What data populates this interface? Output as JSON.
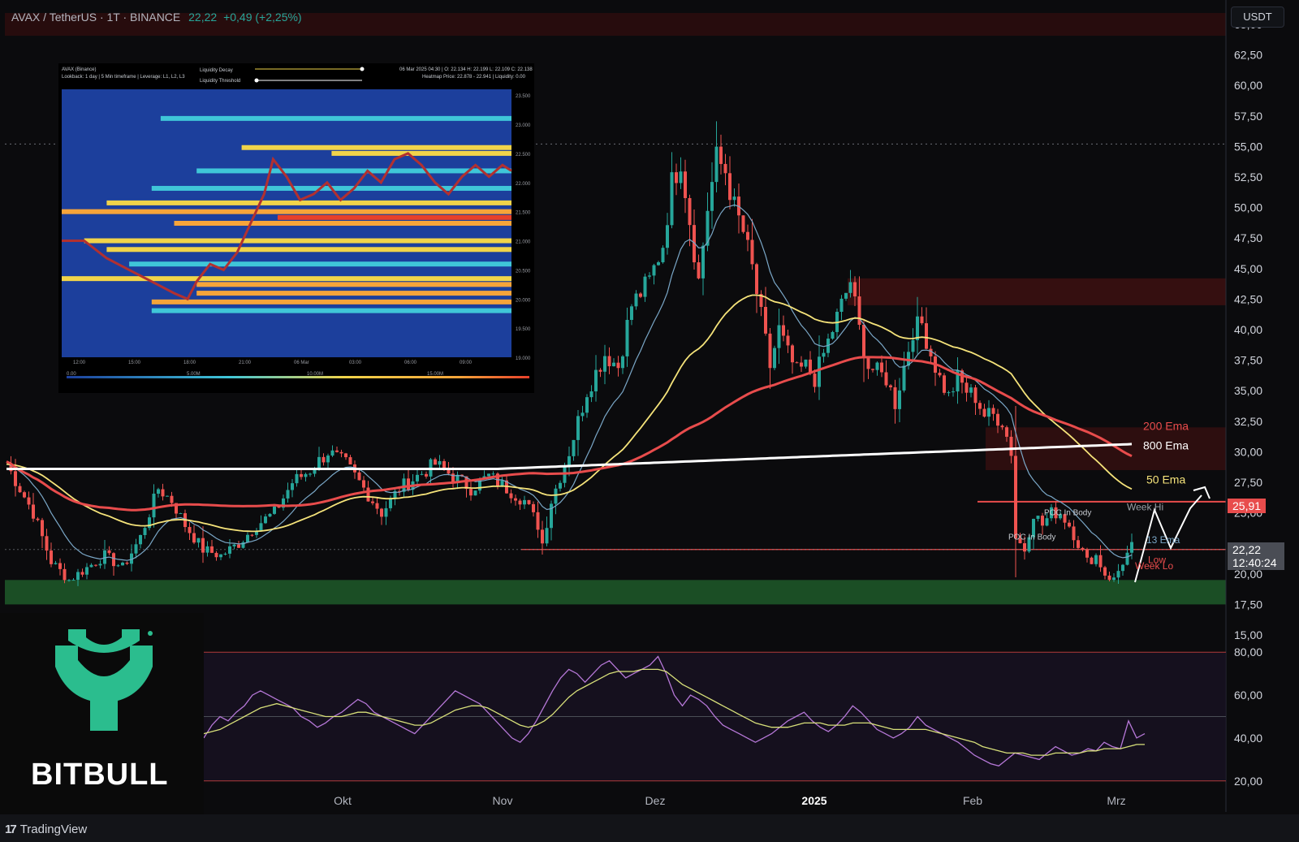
{
  "header": {
    "symbol": "AVAX / TetherUS · 1T · BINANCE",
    "last": "22,22",
    "change": "+0,49 (+2,25%)"
  },
  "currency_button": "USDT",
  "brand": {
    "name": "BITBULL",
    "color": "#2bbd8e"
  },
  "footer": {
    "logo_text": "TradingView"
  },
  "colors": {
    "up": "#26a69a",
    "down": "#ef5350",
    "ema50": "#f5e37a",
    "ema200": "#e84c4c",
    "ema800": "#ffffff",
    "rsi": "#b678d8",
    "rsi_ma": "#d8e07a",
    "support_zone": "#1f5a2a"
  },
  "price_tags": {
    "level": "25,91",
    "current_price": "22,22",
    "countdown": "12:40:24"
  },
  "chart_data": [
    {
      "type": "candlestick",
      "title": "AVAX / TetherUS · 1T · BINANCE",
      "x_ticks": [
        "Okt",
        "Nov",
        "Dez",
        "2025",
        "Feb",
        "Mrz"
      ],
      "y_ticks": [
        "65,00",
        "62,50",
        "60,00",
        "57,50",
        "55,00",
        "52,50",
        "50,00",
        "47,50",
        "45,00",
        "42,50",
        "40,00",
        "37,50",
        "35,00",
        "32,50",
        "30,00",
        "27,50",
        "25,00",
        "22,22",
        "20,00",
        "17,50",
        "15,00"
      ],
      "ylim": [
        15,
        65
      ],
      "close_path": [
        [
          0,
          29
        ],
        [
          6,
          25
        ],
        [
          10,
          21
        ],
        [
          14,
          19.5
        ],
        [
          18,
          20.5
        ],
        [
          22,
          21.5
        ],
        [
          26,
          20.5
        ],
        [
          30,
          23
        ],
        [
          34,
          27
        ],
        [
          37,
          26
        ],
        [
          40,
          24
        ],
        [
          44,
          22
        ],
        [
          48,
          21.5
        ],
        [
          52,
          22.5
        ],
        [
          56,
          24
        ],
        [
          60,
          25
        ],
        [
          64,
          27.5
        ],
        [
          68,
          28.5
        ],
        [
          72,
          30
        ],
        [
          76,
          29
        ],
        [
          80,
          27
        ],
        [
          84,
          25
        ],
        [
          88,
          27
        ],
        [
          92,
          28
        ],
        [
          96,
          29
        ],
        [
          100,
          28
        ],
        [
          104,
          27
        ],
        [
          108,
          28
        ],
        [
          112,
          27
        ],
        [
          116,
          26
        ],
        [
          119,
          24
        ],
        [
          120,
          22.5
        ],
        [
          122,
          26
        ],
        [
          126,
          30
        ],
        [
          130,
          35
        ],
        [
          134,
          38
        ],
        [
          137,
          37
        ],
        [
          140,
          42
        ],
        [
          144,
          44
        ],
        [
          147,
          47
        ],
        [
          149,
          52
        ],
        [
          151,
          54
        ],
        [
          153,
          49
        ],
        [
          155,
          44
        ],
        [
          157,
          50
        ],
        [
          159,
          54
        ],
        [
          161,
          53
        ],
        [
          163,
          50
        ],
        [
          165,
          48
        ],
        [
          167,
          45
        ],
        [
          169,
          41
        ],
        [
          171,
          37
        ],
        [
          173,
          40
        ],
        [
          175,
          38
        ],
        [
          177,
          36.5
        ],
        [
          179,
          37
        ],
        [
          181,
          36
        ],
        [
          183,
          38
        ],
        [
          185,
          40
        ],
        [
          187,
          42
        ],
        [
          189,
          44
        ],
        [
          191,
          40
        ],
        [
          193,
          37
        ],
        [
          195,
          36.5
        ],
        [
          197,
          36
        ],
        [
          199,
          34
        ],
        [
          201,
          37
        ],
        [
          203,
          40
        ],
        [
          205,
          40.5
        ],
        [
          207,
          38
        ],
        [
          209,
          36
        ],
        [
          211,
          34.5
        ],
        [
          213,
          36
        ],
        [
          215,
          35
        ],
        [
          217,
          34.5
        ],
        [
          219,
          33
        ],
        [
          221,
          33
        ],
        [
          223,
          32.5
        ],
        [
          225,
          30
        ],
        [
          226,
          23
        ],
        [
          228,
          22
        ],
        [
          230,
          25
        ],
        [
          232,
          24
        ],
        [
          234,
          25
        ],
        [
          236,
          25
        ],
        [
          238,
          24
        ],
        [
          240,
          22.5
        ],
        [
          242,
          21
        ],
        [
          244,
          21.5
        ],
        [
          246,
          20
        ],
        [
          248,
          19.5
        ],
        [
          250,
          21
        ],
        [
          252,
          22.22
        ]
      ],
      "annotations": [
        "200 Ema",
        "800 Ema",
        "50 Ema",
        "Week Hi",
        "POC In Body",
        "POC In Body",
        "13 Ema",
        "Week Lo",
        "Low"
      ],
      "horizontal_levels": [
        25.91,
        22.0
      ],
      "support_zone": [
        17.5,
        19.5
      ],
      "grid": false
    },
    {
      "type": "line",
      "title": "RSI",
      "y_ticks": [
        "80,00",
        "60,00",
        "40,00",
        "20,00"
      ],
      "ylim": [
        15,
        85
      ],
      "bands": [
        20,
        50,
        80
      ],
      "series": [
        {
          "values": [
            40,
            46,
            50,
            48,
            52,
            55,
            60,
            62,
            60,
            58,
            56,
            54,
            50,
            48,
            45,
            47,
            50,
            52,
            55,
            58,
            56,
            52,
            50,
            48,
            46,
            44,
            42,
            46,
            50,
            54,
            58,
            62,
            60,
            58,
            56,
            52,
            48,
            44,
            40,
            38,
            42,
            48,
            55,
            62,
            68,
            72,
            70,
            66,
            70,
            74,
            76,
            72,
            68,
            70,
            72,
            74,
            78,
            70,
            60,
            55,
            60,
            58,
            55,
            50,
            46,
            44,
            42,
            40,
            38,
            40,
            42,
            45,
            48,
            50,
            52,
            48,
            45,
            43,
            46,
            50,
            55,
            52,
            48,
            44,
            42,
            40,
            42,
            45,
            50,
            46,
            44,
            42,
            40,
            38,
            35,
            32,
            30,
            28,
            27,
            30,
            33,
            32,
            31,
            30,
            33,
            36,
            34,
            32,
            33,
            35,
            34,
            38,
            36,
            35,
            48,
            40,
            42
          ]
        },
        {
          "values": [
            42,
            43,
            44,
            46,
            48,
            50,
            52,
            54,
            55,
            56,
            55,
            54,
            53,
            52,
            51,
            50,
            50,
            50,
            51,
            52,
            52,
            51,
            50,
            49,
            48,
            47,
            46,
            46,
            47,
            49,
            51,
            53,
            54,
            55,
            55,
            54,
            52,
            50,
            48,
            46,
            45,
            46,
            48,
            51,
            55,
            59,
            62,
            64,
            66,
            68,
            70,
            71,
            71,
            71,
            72,
            72,
            72,
            71,
            68,
            65,
            63,
            61,
            59,
            57,
            55,
            53,
            51,
            49,
            47,
            46,
            45,
            45,
            45,
            46,
            47,
            47,
            47,
            46,
            46,
            46,
            47,
            47,
            47,
            46,
            45,
            44,
            44,
            44,
            44,
            44,
            43,
            42,
            41,
            40,
            39,
            38,
            36,
            35,
            34,
            33,
            33,
            33,
            32,
            32,
            32,
            33,
            33,
            33,
            33,
            34,
            34,
            35,
            35,
            35,
            36,
            37,
            37
          ]
        }
      ]
    },
    {
      "type": "heatmap",
      "title": "AVAX (Binance)",
      "texts": {
        "lookback": "Lookback: 1 day | 5 Min timeframe | Leverage: L1, L2, L3",
        "decay": "Liquidity Decay",
        "threshold": "Liquidity Threshold",
        "ohlc": "06 Mar 2025 04:30 | O: 22.134 H: 22.199 L: 22.109 C: 22.138",
        "heat": "Heatmap Price: 22.878 - 22.941 | Liquidity: 0.00"
      },
      "x_ticks": [
        "12:00",
        "15:00",
        "18:00",
        "21:00",
        "06 Mar",
        "03:00",
        "06:00",
        "09:00"
      ],
      "y_ticks": [
        "23.500",
        "23.000",
        "22.500",
        "22.000",
        "21.500",
        "21.000",
        "20.500",
        "20.000",
        "19.500",
        "19.000"
      ],
      "legend_ticks": [
        "0.00",
        "5.00M",
        "10.00M",
        "15.00M"
      ],
      "ylim": [
        19.0,
        23.6
      ],
      "price_path": [
        [
          0,
          21.0
        ],
        [
          5,
          21.0
        ],
        [
          10,
          20.7
        ],
        [
          15,
          20.5
        ],
        [
          20,
          20.3
        ],
        [
          25,
          20.1
        ],
        [
          28,
          20.0
        ],
        [
          30,
          20.3
        ],
        [
          33,
          20.6
        ],
        [
          36,
          20.5
        ],
        [
          39,
          20.8
        ],
        [
          42,
          21.3
        ],
        [
          45,
          21.8
        ],
        [
          47,
          22.4
        ],
        [
          50,
          22.1
        ],
        [
          53,
          21.7
        ],
        [
          56,
          21.8
        ],
        [
          59,
          22.0
        ],
        [
          62,
          21.7
        ],
        [
          65,
          21.9
        ],
        [
          68,
          22.2
        ],
        [
          71,
          22.0
        ],
        [
          74,
          22.4
        ],
        [
          77,
          22.5
        ],
        [
          80,
          22.3
        ],
        [
          83,
          22.0
        ],
        [
          86,
          21.8
        ],
        [
          89,
          22.1
        ],
        [
          92,
          22.3
        ],
        [
          95,
          22.1
        ],
        [
          98,
          22.3
        ],
        [
          100,
          22.2
        ]
      ],
      "bands": [
        [
          23.1,
          0.35,
          22,
          100
        ],
        [
          22.6,
          0.55,
          40,
          100
        ],
        [
          22.5,
          0.6,
          60,
          100
        ],
        [
          22.2,
          0.4,
          30,
          100
        ],
        [
          21.9,
          0.45,
          20,
          100
        ],
        [
          21.65,
          0.55,
          10,
          100
        ],
        [
          21.5,
          0.9,
          0,
          100
        ],
        [
          21.4,
          1.0,
          48,
          100
        ],
        [
          21.3,
          0.85,
          25,
          100
        ],
        [
          21.0,
          0.7,
          5,
          100
        ],
        [
          20.85,
          0.6,
          10,
          100
        ],
        [
          20.6,
          0.35,
          15,
          100
        ],
        [
          20.35,
          0.55,
          0,
          100
        ],
        [
          20.25,
          0.8,
          30,
          100
        ],
        [
          20.1,
          0.9,
          30,
          100
        ],
        [
          19.95,
          0.85,
          20,
          100
        ],
        [
          19.8,
          0.5,
          20,
          100
        ]
      ]
    }
  ]
}
